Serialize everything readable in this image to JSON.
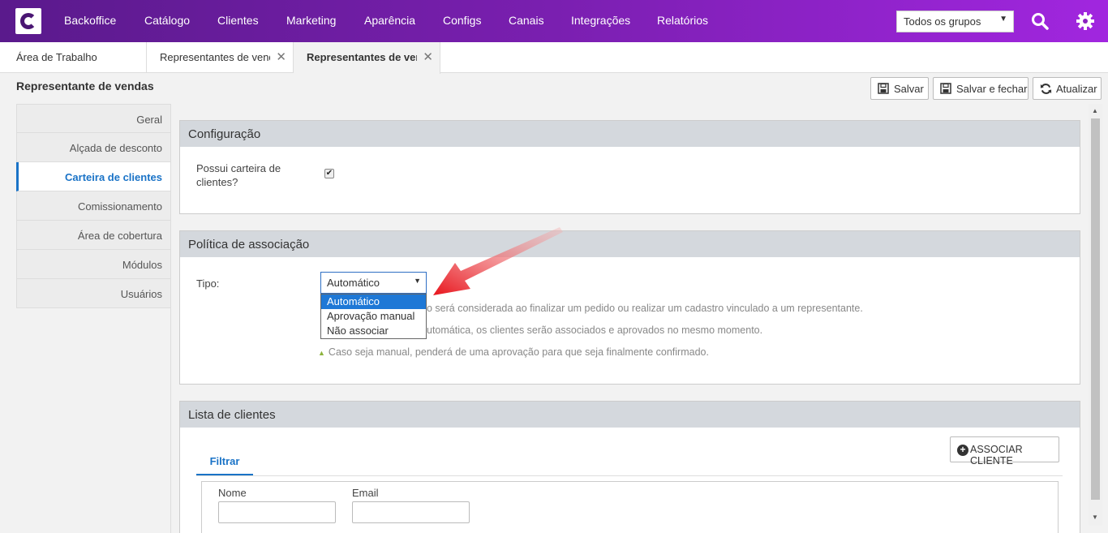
{
  "topbar": {
    "nav": [
      "Backoffice",
      "Catálogo",
      "Clientes",
      "Marketing",
      "Aparência",
      "Configs",
      "Canais",
      "Integrações",
      "Relatórios"
    ],
    "group_select": "Todos os grupos",
    "icons": [
      "search-icon",
      "gear-icon"
    ]
  },
  "tabs": [
    {
      "label": "Área de Trabalho"
    },
    {
      "label": "Representantes de vendas"
    },
    {
      "label": "Representantes de vendas"
    }
  ],
  "page": {
    "title": "Representante de vendas",
    "save_label": "Salvar",
    "save_close_label": "Salvar e fechar",
    "refresh_label": "Atualizar"
  },
  "sidemenu": {
    "items": [
      "Geral",
      "Alçada de desconto",
      "Carteira de clientes",
      "Comissionamento",
      "Área de cobertura",
      "Módulos",
      "Usuários"
    ],
    "active": "Carteira de clientes"
  },
  "config": {
    "title": "Configuração",
    "wallet_label_1": "Possui carteira de",
    "wallet_label_2": "clientes?",
    "wallet_checked": true
  },
  "policy": {
    "title": "Política de associação",
    "type_label": "Tipo:",
    "type_value": "Automático",
    "options": [
      "Automático",
      "Aprovação manual",
      "Não associar"
    ],
    "hints": [
      "o será considerada ao finalizar um pedido ou realizar um cadastro vinculado a um representante.",
      "utomática, os clientes serão associados e aprovados no mesmo momento.",
      "Caso seja manual, penderá de uma aprovação para que seja finalmente confirmado."
    ]
  },
  "clients": {
    "title": "Lista de clientes",
    "associate_label": "ASSOCIAR CLIENTE",
    "filter_tab": "Filtrar",
    "name_label": "Nome",
    "email_label": "Email"
  },
  "colors": {
    "accent": "#1a73c7",
    "topbar_start": "#5a1a8c",
    "topbar_end": "#a126df",
    "arrow": "#e8141c"
  }
}
